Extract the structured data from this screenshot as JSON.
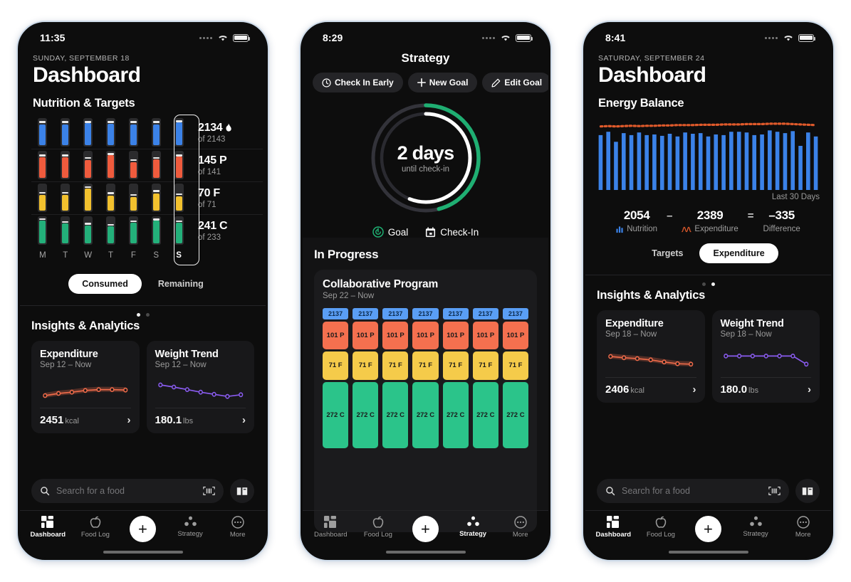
{
  "phone1": {
    "status": {
      "time": "11:35"
    },
    "header": {
      "date": "SUNDAY, SEPTEMBER 18",
      "title": "Dashboard",
      "section": "Nutrition & Targets"
    },
    "nutrition": {
      "day_labels": [
        "M",
        "T",
        "W",
        "T",
        "F",
        "S",
        "S"
      ],
      "selected_index": 6,
      "rows": [
        {
          "key": "calories",
          "color": "#3b82e8",
          "value_label": "2134",
          "unit": "flame",
          "target_label": "of 2143",
          "fills": [
            0.8,
            0.82,
            0.86,
            0.84,
            0.81,
            0.8,
            0.88
          ],
          "caps": [
            0.93,
            0.93,
            0.93,
            0.93,
            0.93,
            0.93,
            0.95
          ]
        },
        {
          "key": "protein",
          "color": "#ef5b3d",
          "value_label": "145 P",
          "unit": "",
          "target_label": "of 141",
          "fills": [
            0.82,
            0.82,
            0.7,
            0.9,
            0.6,
            0.72,
            0.84
          ],
          "caps": [
            0.9,
            0.9,
            0.8,
            0.95,
            0.72,
            0.8,
            0.9
          ]
        },
        {
          "key": "fat",
          "color": "#f2c12e",
          "value_label": "70 F",
          "unit": "",
          "target_label": "of 71",
          "fills": [
            0.62,
            0.62,
            0.86,
            0.58,
            0.52,
            0.68,
            0.56
          ],
          "caps": [
            0.72,
            0.72,
            0.94,
            0.7,
            0.64,
            0.78,
            0.66
          ]
        },
        {
          "key": "carbs",
          "color": "#23b07a",
          "value_label": "241 C",
          "unit": "",
          "target_label": "of 233",
          "fills": [
            0.9,
            0.78,
            0.7,
            0.66,
            0.8,
            0.88,
            0.8
          ],
          "caps": [
            0.96,
            0.86,
            0.78,
            0.74,
            0.88,
            0.95,
            0.88
          ]
        }
      ]
    },
    "segmented": {
      "options": [
        "Consumed",
        "Remaining"
      ],
      "selected": "Consumed"
    },
    "pagedots": {
      "count": 2,
      "active": 0
    },
    "insights": {
      "title": "Insights & Analytics",
      "cards": [
        {
          "title": "Expenditure",
          "subtitle": "Sep 12 – Now",
          "value": "2451",
          "unit": "kcal",
          "chart_type": "line",
          "color": "#ef6b4a",
          "points": [
            0.3,
            0.4,
            0.46,
            0.54,
            0.58,
            0.58,
            0.56
          ]
        },
        {
          "title": "Weight Trend",
          "subtitle": "Sep 12 – Now",
          "value": "180.1",
          "unit": "lbs",
          "chart_type": "line",
          "color": "#8a5cf0",
          "points": [
            0.8,
            0.7,
            0.58,
            0.46,
            0.36,
            0.26,
            0.34
          ]
        }
      ]
    },
    "search": {
      "placeholder": "Search for a food"
    },
    "tabbar": {
      "items": [
        {
          "label": "Dashboard",
          "icon": "grid-icon",
          "active": true
        },
        {
          "label": "Food Log",
          "icon": "apple-icon",
          "active": false
        },
        {
          "label": "",
          "icon": "plus-icon",
          "active": false
        },
        {
          "label": "Strategy",
          "icon": "dots-triangle-icon",
          "active": false
        },
        {
          "label": "More",
          "icon": "ellipsis-circle-icon",
          "active": false
        }
      ]
    }
  },
  "phone2": {
    "status": {
      "time": "8:29"
    },
    "header": {
      "title": "Strategy"
    },
    "chips": [
      {
        "label": "Check In Early",
        "icon": "clock-icon"
      },
      {
        "label": "New Goal",
        "icon": "plus-icon"
      },
      {
        "label": "Edit Goal",
        "icon": "pencil-icon"
      }
    ],
    "ring": {
      "big": "2 days",
      "sub": "until check-in",
      "outer_color": "#1fae72",
      "inner_color": "#ffffff",
      "track_color": "#33333a",
      "outer_pct": 0.46,
      "inner_pct": 0.56
    },
    "ring_legend": [
      {
        "label": "Goal",
        "icon": "goal-target-icon",
        "color": "#1fae72"
      },
      {
        "label": "Check-In",
        "icon": "calendar-icon",
        "color": "#ffffff"
      }
    ],
    "in_progress": {
      "title": "In Progress",
      "card": {
        "title": "Collaborative Program",
        "subtitle": "Sep 22 – Now",
        "columns": 7,
        "pill_label": "2137",
        "pill_color": "#5a9ef5",
        "blocks": [
          {
            "label": "101 P",
            "color": "#f4704f",
            "weight": 1.0
          },
          {
            "label": "71 F",
            "color": "#f5cb4a",
            "weight": 1.05
          },
          {
            "label": "272 C",
            "color": "#2bc48a",
            "weight": 2.4
          }
        ]
      }
    },
    "tabbar": {
      "items": [
        {
          "label": "Dashboard",
          "icon": "grid-icon",
          "active": false
        },
        {
          "label": "Food Log",
          "icon": "apple-icon",
          "active": false
        },
        {
          "label": "",
          "icon": "plus-icon",
          "active": false
        },
        {
          "label": "Strategy",
          "icon": "dots-triangle-icon",
          "active": true
        },
        {
          "label": "More",
          "icon": "ellipsis-circle-icon",
          "active": false
        }
      ]
    }
  },
  "phone3": {
    "status": {
      "time": "8:41"
    },
    "header": {
      "date": "SATURDAY, SEPTEMBER 24",
      "title": "Dashboard",
      "section": "Energy Balance"
    },
    "chart_data": {
      "type": "bar",
      "title": "Energy Balance",
      "caption": "Last 30 Days",
      "xlabel": "",
      "ylabel": "",
      "grid": false,
      "legend_position": "below",
      "bar_color": "#3b82e8",
      "line_color": "#e05a2b",
      "line_style": "dotted",
      "series": [
        {
          "name": "Nutrition",
          "type": "bar",
          "values": [
            0.82,
            0.87,
            0.72,
            0.85,
            0.82,
            0.86,
            0.82,
            0.83,
            0.81,
            0.84,
            0.8,
            0.86,
            0.84,
            0.85,
            0.8,
            0.83,
            0.82,
            0.87,
            0.87,
            0.86,
            0.82,
            0.83,
            0.89,
            0.87,
            0.85,
            0.88,
            0.66,
            0.86,
            0.8
          ]
        },
        {
          "name": "Expenditure",
          "type": "line",
          "values": [
            0.95,
            0.955,
            0.95,
            0.955,
            0.96,
            0.955,
            0.96,
            0.96,
            0.965,
            0.965,
            0.97,
            0.97,
            0.97,
            0.975,
            0.975,
            0.975,
            0.98,
            0.98,
            0.98,
            0.985,
            0.985,
            0.985,
            0.99,
            0.99,
            0.99,
            0.985,
            0.98,
            0.975,
            0.97
          ]
        }
      ]
    },
    "equation": {
      "nutrition": {
        "value": "2054",
        "label": "Nutrition",
        "icon": "bar-chart-icon",
        "color": "#3b82e8"
      },
      "op1": "–",
      "expenditure": {
        "value": "2389",
        "label": "Expenditure",
        "icon": "wave-icon",
        "color": "#e05a2b"
      },
      "op2": "=",
      "difference": {
        "value": "–335",
        "label": "Difference"
      }
    },
    "segmented": {
      "options": [
        "Targets",
        "Expenditure"
      ],
      "selected": "Expenditure"
    },
    "pagedots": {
      "count": 2,
      "active": 1
    },
    "insights": {
      "title": "Insights & Analytics",
      "cards": [
        {
          "title": "Expenditure",
          "subtitle": "Sep 18 – Now",
          "value": "2406",
          "unit": "kcal",
          "chart_type": "line",
          "color": "#ef6b4a",
          "points": [
            0.7,
            0.64,
            0.6,
            0.54,
            0.44,
            0.36,
            0.34
          ]
        },
        {
          "title": "Weight Trend",
          "subtitle": "Sep 18 – Now",
          "value": "180.0",
          "unit": "lbs",
          "chart_type": "line",
          "color": "#8a5cf0",
          "points": [
            0.72,
            0.72,
            0.72,
            0.72,
            0.72,
            0.72,
            0.34
          ]
        }
      ]
    },
    "search": {
      "placeholder": "Search for a food"
    },
    "tabbar": {
      "items": [
        {
          "label": "Dashboard",
          "icon": "grid-icon",
          "active": true
        },
        {
          "label": "Food Log",
          "icon": "apple-icon",
          "active": false
        },
        {
          "label": "",
          "icon": "plus-icon",
          "active": false
        },
        {
          "label": "Strategy",
          "icon": "dots-triangle-icon",
          "active": false
        },
        {
          "label": "More",
          "icon": "ellipsis-circle-icon",
          "active": false
        }
      ]
    }
  }
}
